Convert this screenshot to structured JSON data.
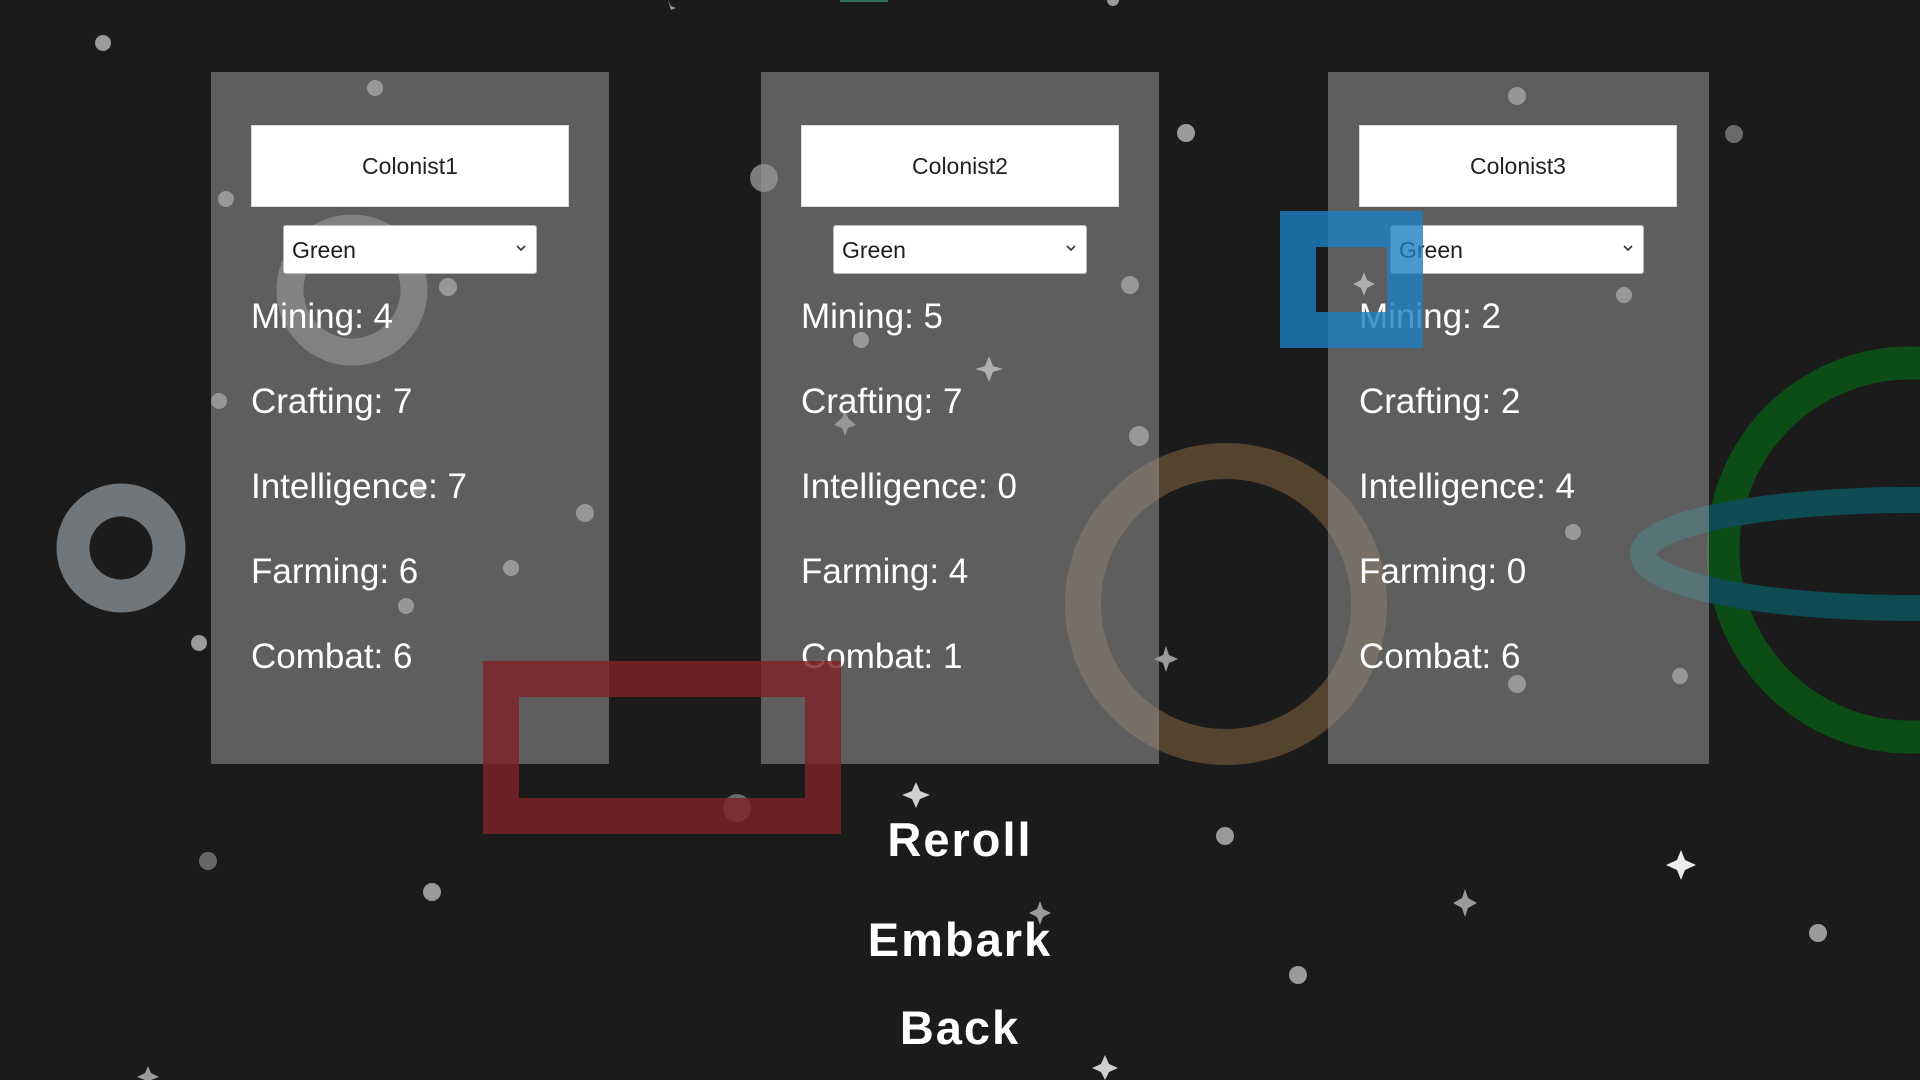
{
  "colors": {
    "background": "#1b1b1b",
    "panel": "#7a7a7a",
    "text": "#ffffff",
    "red_shape": "#7e2228",
    "blue_shape": "#1c7ec4",
    "brown_ring": "#54442f",
    "gray_ring": "#70767a",
    "green_ring": "#0b4d14",
    "teal_ring": "#0e4b52"
  },
  "colonists": [
    {
      "name": "Colonist1",
      "color": "Green",
      "stats": [
        {
          "label": "Mining: 4"
        },
        {
          "label": "Crafting: 7"
        },
        {
          "label": "Intelligence: 7"
        },
        {
          "label": "Farming: 6"
        },
        {
          "label": "Combat: 6"
        }
      ]
    },
    {
      "name": "Colonist2",
      "color": "Green",
      "stats": [
        {
          "label": "Mining: 5"
        },
        {
          "label": "Crafting: 7"
        },
        {
          "label": "Intelligence: 0"
        },
        {
          "label": "Farming: 4"
        },
        {
          "label": "Combat: 1"
        }
      ]
    },
    {
      "name": "Colonist3",
      "color": "Green",
      "stats": [
        {
          "label": "Mining: 2"
        },
        {
          "label": "Crafting: 2"
        },
        {
          "label": "Intelligence: 4"
        },
        {
          "label": "Farming: 0"
        },
        {
          "label": "Combat: 6"
        }
      ]
    }
  ],
  "menu": {
    "reroll": "Reroll",
    "embark": "Embark",
    "back": "Back"
  },
  "icons": {
    "dropdown": "chevron-down-icon",
    "stars": "star-icon"
  }
}
